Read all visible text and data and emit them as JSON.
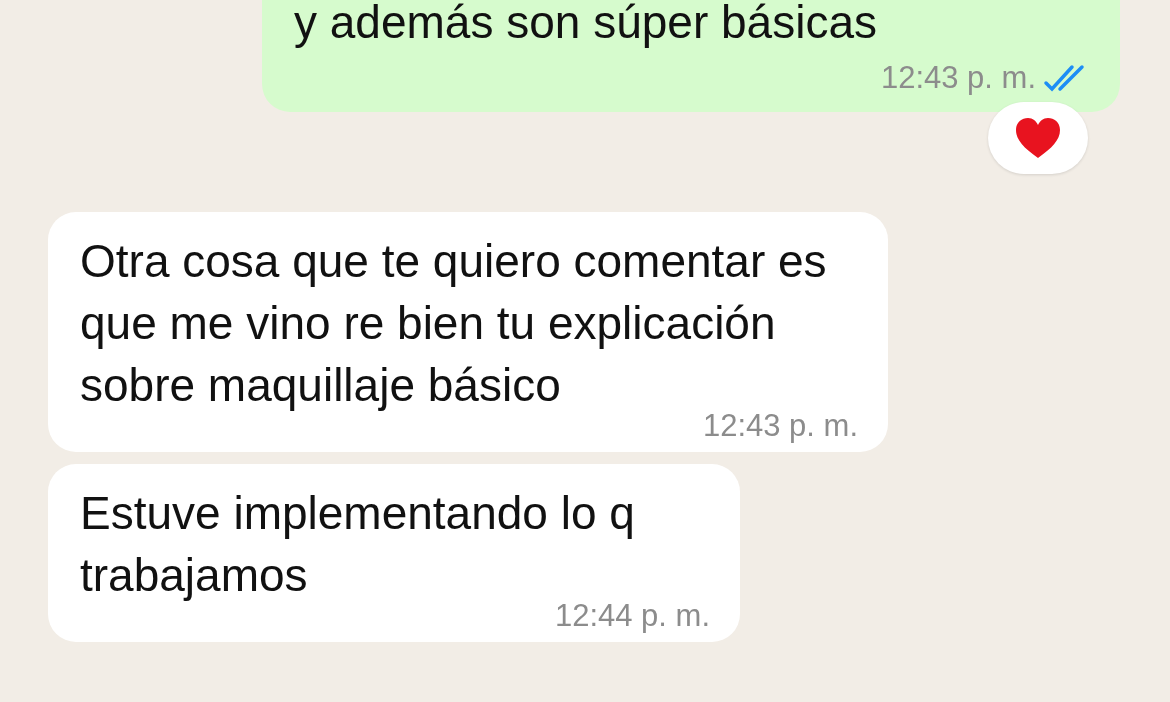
{
  "messages": [
    {
      "kind": "outgoing",
      "text": "y además son súper básicas",
      "time": "12:43 p. m.",
      "read": true,
      "reaction": {
        "kind": "heart"
      }
    },
    {
      "kind": "incoming",
      "text": "Otra cosa que te quiero comentar es que me vino re bien tu explicación sobre maquillaje básico",
      "time": "12:43 p. m."
    },
    {
      "kind": "incoming",
      "text": "Estuve implementando lo q trabajamos",
      "time": "12:44 p. m."
    }
  ]
}
